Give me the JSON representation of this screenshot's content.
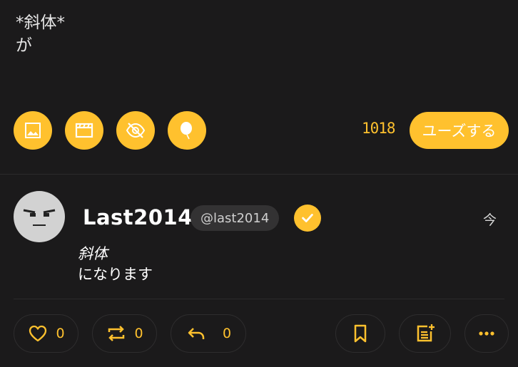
{
  "composer": {
    "line1": "*斜体*",
    "line2": "が",
    "char_count": "1018",
    "post_label": "ユーズする"
  },
  "toolbar": {
    "icons": [
      "image-icon",
      "video-icon",
      "eye-off-icon",
      "balloon-icon"
    ]
  },
  "post": {
    "display_name": "Last2014",
    "handle": "@last2014",
    "verified": true,
    "timestamp": "今",
    "body_italic": "斜体",
    "body_text": "になります"
  },
  "actions": {
    "like_count": "0",
    "renote_count": "0",
    "reply_count": "0"
  },
  "colors": {
    "accent": "#ffc12e",
    "background": "#1b1a1b",
    "avatar": "#d2d2d2"
  }
}
